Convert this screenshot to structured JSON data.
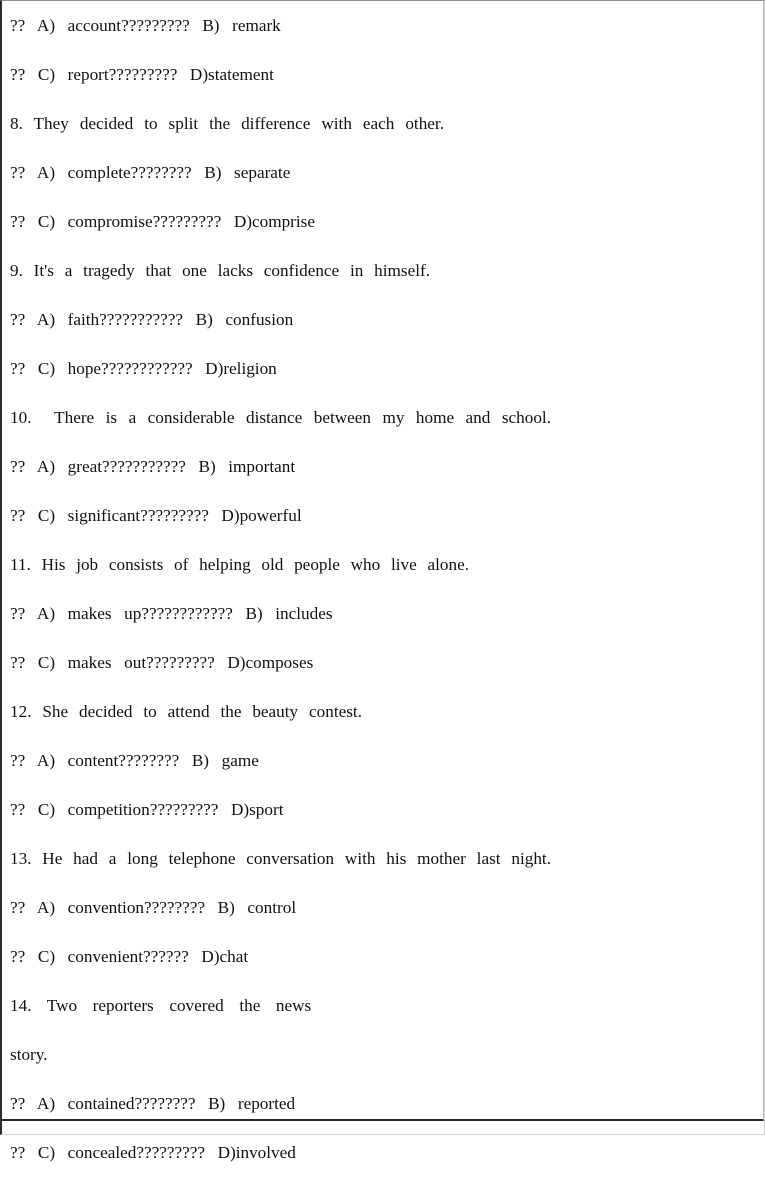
{
  "document": {
    "type": "vocabulary-multiple-choice-worksheet",
    "lines": [
      {
        "id": "q7-ab",
        "kind": "options",
        "text": "??  A)  account?????????  B)  remark"
      },
      {
        "id": "q7-cd",
        "kind": "options",
        "text": "??  C)  report?????????  D)statement"
      },
      {
        "id": "q8",
        "kind": "stem",
        "text": "8.  They  decided  to  split  the  difference  with  each  other."
      },
      {
        "id": "q8-ab",
        "kind": "options",
        "text": "??  A)  complete????????  B)  separate"
      },
      {
        "id": "q8-cd",
        "kind": "options",
        "text": "??  C)  compromise?????????  D)comprise"
      },
      {
        "id": "q9",
        "kind": "stem",
        "text": "9.  It's  a  tragedy  that  one  lacks  confidence  in  himself."
      },
      {
        "id": "q9-ab",
        "kind": "options",
        "text": "??  A)  faith???????????  B)  confusion"
      },
      {
        "id": "q9-cd",
        "kind": "options",
        "text": "??  C)  hope????????????  D)religion"
      },
      {
        "id": "q10",
        "kind": "stem",
        "text": "10.    There  is  a  considerable  distance  between  my  home  and  school."
      },
      {
        "id": "q10-ab",
        "kind": "options",
        "text": "??  A)  great???????????  B)  important"
      },
      {
        "id": "q10-cd",
        "kind": "options",
        "text": "??  C)  significant?????????  D)powerful"
      },
      {
        "id": "q11",
        "kind": "stem",
        "text": "11.  His  job  consists  of  helping  old  people  who  live  alone."
      },
      {
        "id": "q11-ab",
        "kind": "options",
        "text": "??  A)  makes  up????????????  B)  includes"
      },
      {
        "id": "q11-cd",
        "kind": "options",
        "text": "??  C)  makes  out?????????  D)composes"
      },
      {
        "id": "q12",
        "kind": "stem",
        "text": "12.  She  decided  to  attend  the  beauty  contest."
      },
      {
        "id": "q12-ab",
        "kind": "options",
        "text": "??  A)  content????????  B)  game"
      },
      {
        "id": "q12-cd",
        "kind": "options",
        "text": "??  C)  competition?????????  D)sport"
      },
      {
        "id": "q13",
        "kind": "stem",
        "text": "13.  He  had  a  long  telephone  conversation  with  his  mother  last  night."
      },
      {
        "id": "q13-ab",
        "kind": "options",
        "text": "??  A)  convention????????  B)  control"
      },
      {
        "id": "q13-cd",
        "kind": "options",
        "text": "??  C)  convenient??????  D)chat"
      },
      {
        "id": "q14",
        "kind": "stem",
        "text": "14.  Two  reporters  covered  the  news  story."
      },
      {
        "id": "q14-ab",
        "kind": "options",
        "text": "??  A)  contained????????  B)  reported"
      },
      {
        "id": "q14-cd",
        "kind": "options",
        "text": "??  C)  concealed?????????  D)involved"
      }
    ],
    "colors": {
      "text": "#111111",
      "page_background": "#ffffff",
      "border_dark": "#2b2b2b",
      "border_light": "#cfcfcf"
    }
  }
}
